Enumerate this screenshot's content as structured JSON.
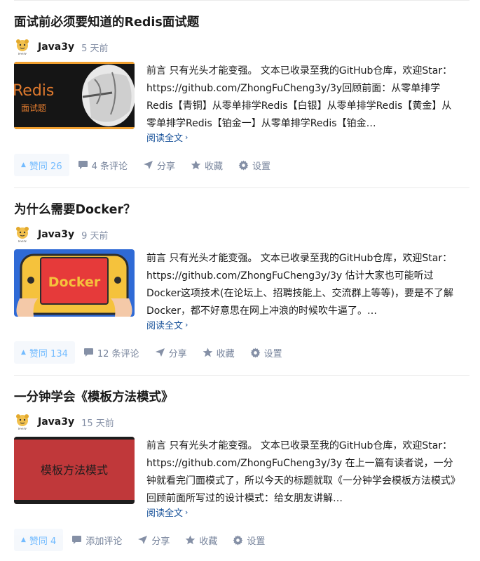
{
  "articles": [
    {
      "title": "面试前必须要知道的Redis面试题",
      "author": "Java3y",
      "time": "5 天前",
      "excerpt": "前言 只有光头才能变强。 文本已收录至我的GitHub仓库，欢迎Star：https://github.com/ZhongFuCheng3y/3y回顾前面：从零单排学Redis【青铜】从零单排学Redis【白银】从零单排学Redis【黄金】从零单排学Redis【铂金一】从零单排学Redis【铂金…",
      "read_more": "阅读全文",
      "vote": "赞同 26",
      "comments": "4 条评论",
      "share": "分享",
      "collect": "收藏",
      "settings": "设置",
      "cover_text": [
        "Redis",
        "面试题"
      ]
    },
    {
      "title": "为什么需要Docker？",
      "author": "Java3y",
      "time": "9 天前",
      "excerpt": "前言 只有光头才能变强。 文本已收录至我的GitHub仓库，欢迎Star：https://github.com/ZhongFuCheng3y/3y 估计大家也可能听过Docker这项技术(在论坛上、招聘技能上、交流群上等等)，要是不了解Docker，都不好意思在网上冲浪的时候吹牛逼了。…",
      "read_more": "阅读全文",
      "vote": "赞同 134",
      "comments": "12 条评论",
      "share": "分享",
      "collect": "收藏",
      "settings": "设置",
      "cover_text": [
        "Docker"
      ]
    },
    {
      "title": "一分钟学会《模板方法模式》",
      "author": "Java3y",
      "time": "15 天前",
      "excerpt": "前言 只有光头才能变强。 文本已收录至我的GitHub仓库，欢迎Star：https://github.com/ZhongFuCheng3y/3y 在上一篇有读者说，一分钟就看完门面模式了，所以今天的标题就取《一分钟学会模板方法模式》回顾前面所写过的设计模式：给女朋友讲解…",
      "read_more": "阅读全文",
      "vote": "赞同 4",
      "comments": "添加评论",
      "share": "分享",
      "collect": "收藏",
      "settings": "设置",
      "cover_text": [
        "模板方法模式"
      ]
    }
  ],
  "colors": {
    "link": "#175199",
    "meta": "#8590a6",
    "vote_fg": "#0084ff",
    "vote_bg": "#eef4fb"
  }
}
